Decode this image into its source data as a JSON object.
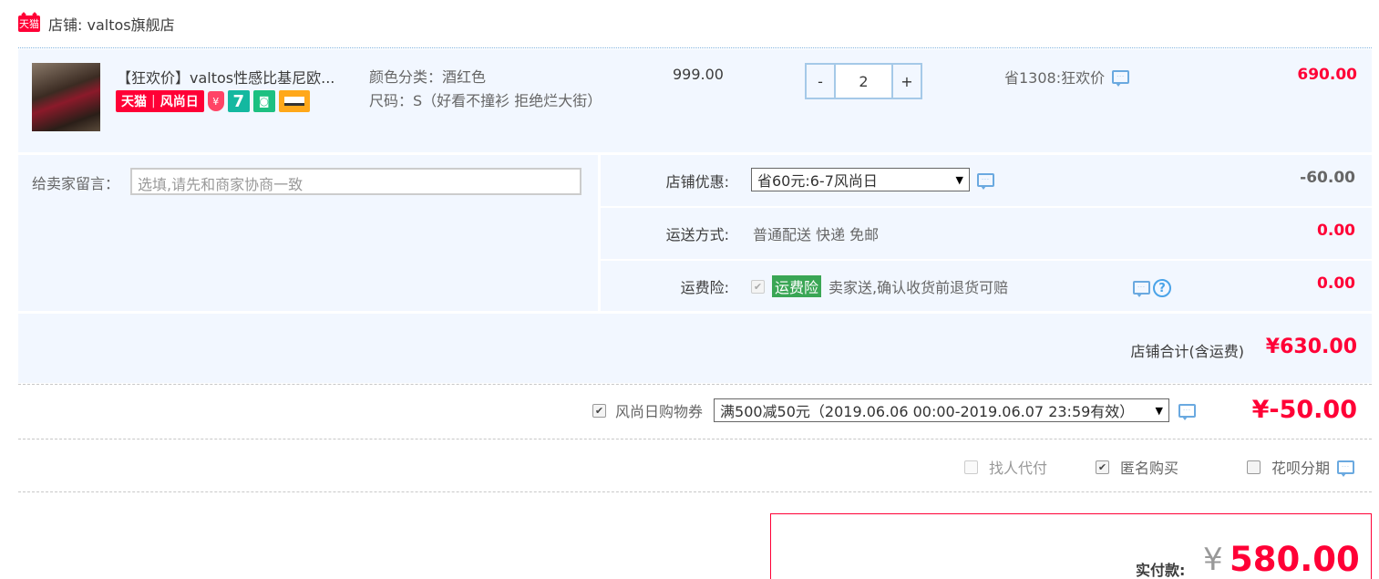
{
  "shop": {
    "icon_text": "天猫",
    "label": "店铺: valtos旗舰店"
  },
  "item": {
    "title": "【狂欢价】valtos性感比基尼欧...",
    "badge_left": "天猫",
    "badge_right": "风尚日",
    "badge_seven": "7",
    "sku_color": "颜色分类：酒红色",
    "sku_size": "尺码：S（好看不撞衫 拒绝烂大街）",
    "price": "999.00",
    "quantity": "2",
    "qty_minus": "-",
    "qty_plus": "+",
    "promo": "省1308:狂欢价",
    "total": "690.00"
  },
  "message": {
    "label": "给卖家留言：",
    "placeholder": "选填,请先和商家协商一致"
  },
  "store_discount": {
    "label": "店铺优惠:",
    "selected": "省60元:6-7风尚日",
    "value": "-60.00"
  },
  "shipping": {
    "label": "运送方式:",
    "method": "普通配送 快递 免邮",
    "value": "0.00"
  },
  "insurance": {
    "label": "运费险:",
    "tag": "运费险",
    "desc": "卖家送,确认收货前退货可赔",
    "value": "0.00"
  },
  "store_total": {
    "label": "店铺合计(含运费)",
    "value": "¥630.00"
  },
  "coupon": {
    "label": "风尚日购物券",
    "selected": "满500减50元（2019.06.06 00:00-2019.06.07 23:59有效）",
    "value": "¥-50.00"
  },
  "options": {
    "proxy_pay": "找人代付",
    "anonymous": "匿名购买",
    "installment": "花呗分期"
  },
  "payment": {
    "label": "实付款:",
    "currency": "¥",
    "amount": "580.00"
  },
  "colors": {
    "accent_red": "#ff0036",
    "panel_bg": "#f2f7ff",
    "link_blue": "#6aa9e0",
    "ins_green": "#3aa655"
  }
}
